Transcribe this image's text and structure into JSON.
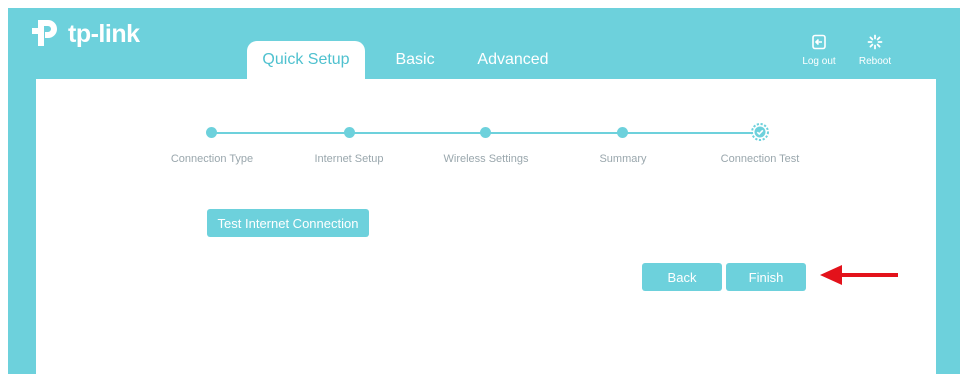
{
  "brand": {
    "name": "tp-link"
  },
  "tabs": [
    {
      "label": "Quick Setup",
      "active": true
    },
    {
      "label": "Basic",
      "active": false
    },
    {
      "label": "Advanced",
      "active": false
    }
  ],
  "top_actions": {
    "logout": {
      "label": "Log out",
      "icon": "logout-icon"
    },
    "reboot": {
      "label": "Reboot",
      "icon": "reboot-icon"
    }
  },
  "steps": [
    {
      "label": "Connection Type",
      "state": "completed"
    },
    {
      "label": "Internet Setup",
      "state": "completed"
    },
    {
      "label": "Wireless Settings",
      "state": "completed"
    },
    {
      "label": "Summary",
      "state": "completed"
    },
    {
      "label": "Connection Test",
      "state": "current"
    }
  ],
  "buttons": {
    "test_connection": "Test Internet Connection",
    "back": "Back",
    "finish": "Finish"
  },
  "annotation": {
    "arrow_color": "#e3121b",
    "points_to": "finish-button"
  },
  "colors": {
    "accent": "#6dd1dc",
    "tab_active_text": "#4fc1cf",
    "step_label": "#9aa7ad"
  }
}
